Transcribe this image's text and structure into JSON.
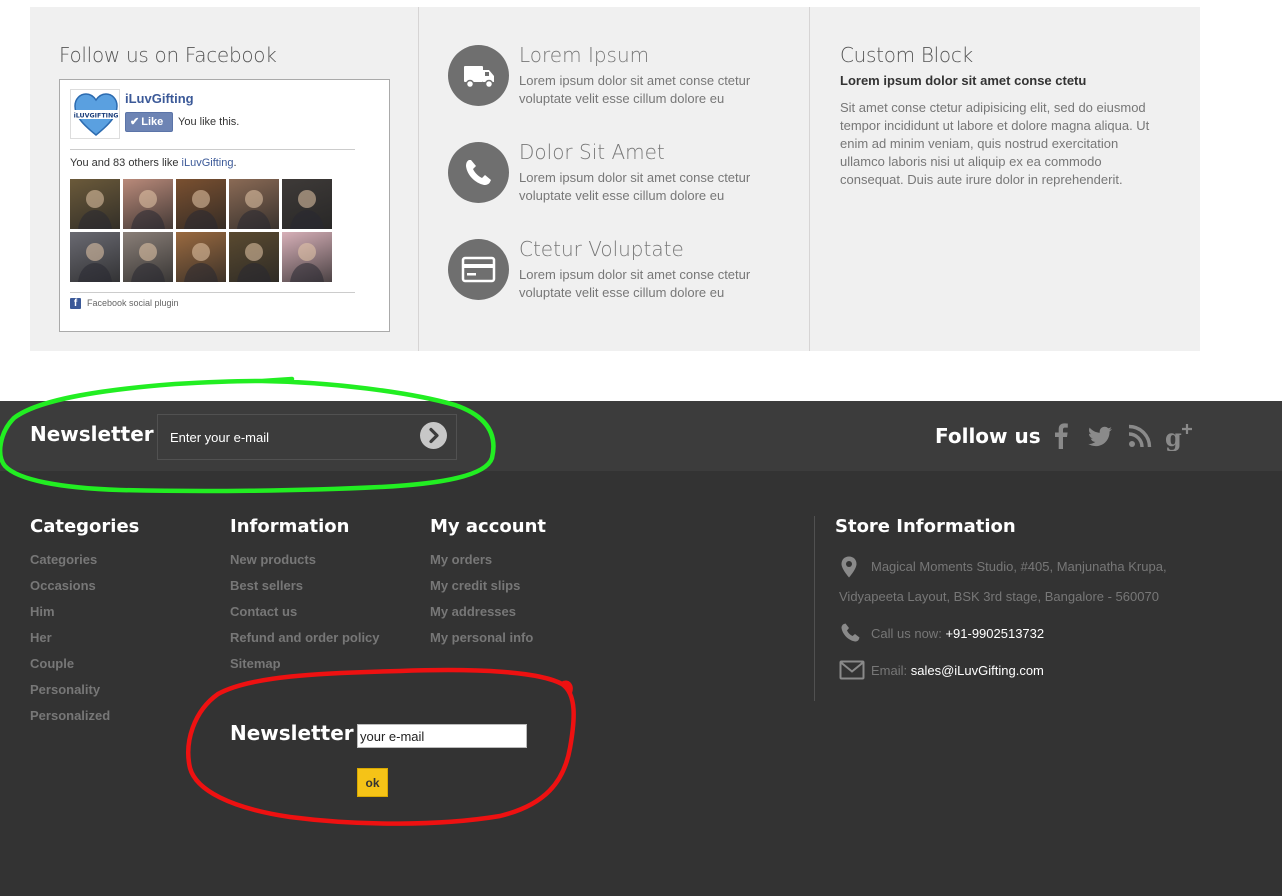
{
  "facebook": {
    "title": "Follow us on Facebook",
    "page_name": "iLuvGifting",
    "logo_text": "iLUVGIFTING",
    "like_label": "Like",
    "you_like": "You like this.",
    "count_text": "You and 83 others like",
    "count_link": "iLuvGifting",
    "count_end": ".",
    "plugin_text": "Facebook social plugin",
    "face_colors": [
      "#6b5a3a",
      "#b98a7a",
      "#7a5030",
      "#8a6a55",
      "#3e3a38",
      "#6a6a72",
      "#8a7f78",
      "#9a6a40",
      "#5a4a30",
      "#d7b0b8"
    ]
  },
  "services": [
    {
      "title": "Lorem Ipsum",
      "text": "Lorem ipsum dolor sit amet conse ctetur voluptate velit esse cillum dolore eu",
      "icon": "truck-icon"
    },
    {
      "title": "Dolor Sit Amet",
      "text": "Lorem ipsum dolor sit amet conse ctetur voluptate velit esse cillum dolore eu",
      "icon": "phone-icon"
    },
    {
      "title": "Ctetur Voluptate",
      "text": "Lorem ipsum dolor sit amet conse ctetur voluptate velit esse cillum dolore eu",
      "icon": "credit-card-icon"
    }
  ],
  "custom_block": {
    "title": "Custom Block",
    "subtitle": "Lorem ipsum dolor sit amet conse ctetu",
    "text": "Sit amet conse ctetur adipisicing elit, sed do eiusmod tempor incididunt ut labore et dolore magna aliqua. Ut enim ad minim veniam, quis nostrud exercitation ullamco laboris nisi ut aliquip ex ea commodo consequat. Duis aute irure dolor in reprehenderit."
  },
  "newsletter_bar": {
    "title": "Newsletter",
    "placeholder": "Enter your e-mail"
  },
  "follow": {
    "title": "Follow us",
    "icons": [
      "facebook-icon",
      "twitter-icon",
      "rss-icon",
      "google-plus-icon"
    ]
  },
  "categories": {
    "title": "Categories",
    "items": [
      "Categories",
      "Occasions",
      "Him",
      "Her",
      "Couple",
      "Personality",
      "Personalized"
    ]
  },
  "information": {
    "title": "Information",
    "items": [
      "New products",
      "Best sellers",
      "Contact us",
      "Refund and order policy",
      "Sitemap"
    ]
  },
  "account": {
    "title": "My account",
    "items": [
      "My orders",
      "My credit slips",
      "My addresses",
      "My personal info"
    ]
  },
  "store": {
    "title": "Store Information",
    "address": "Magical Moments Studio, #405, Manjunatha Krupa, Vidyapeeta Layout, BSK 3rd stage, Bangalore - 560070",
    "call_label": "Call us now:",
    "phone": "+91-9902513732",
    "email_label": "Email:",
    "email": "sales@iLuvGifting.com"
  },
  "newsletter_block": {
    "title": "Newsletter",
    "value": "your e-mail",
    "ok_label": "ok"
  },
  "annotations": {
    "green": "#22ee22",
    "red": "#ee1111"
  }
}
